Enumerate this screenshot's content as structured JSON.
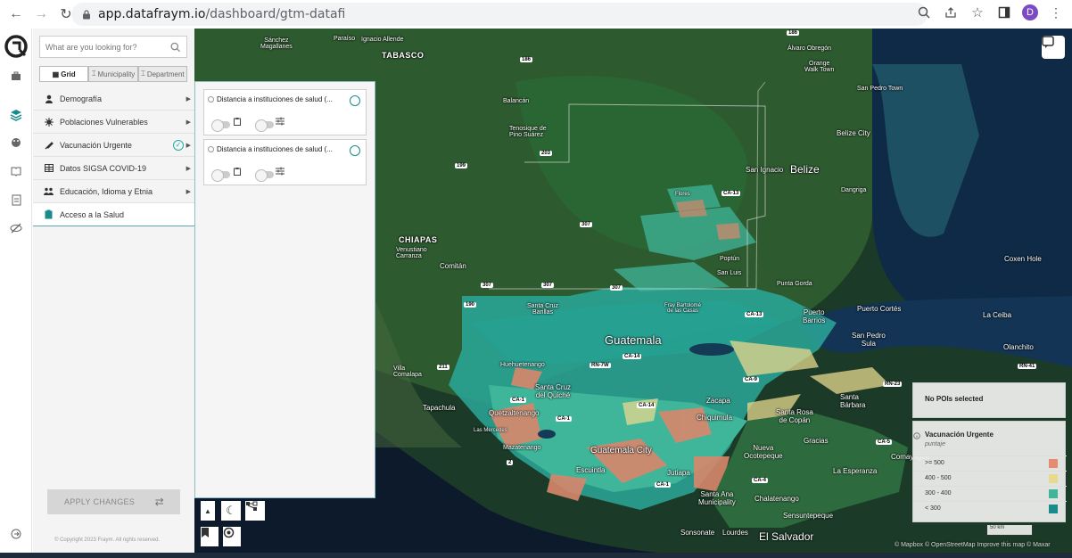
{
  "browser": {
    "url_host": "app.datafraym.io",
    "url_path": "/dashboard/gtm-datafi",
    "profile_initial": "D"
  },
  "search": {
    "placeholder": "What are you looking for?"
  },
  "tabs": [
    {
      "label": "Grid"
    },
    {
      "label": "Municipality"
    },
    {
      "label": "Department"
    }
  ],
  "menu": [
    {
      "label": "Demografía",
      "icon": "person-icon"
    },
    {
      "label": "Poblaciones Vulnerables",
      "icon": "virus-icon"
    },
    {
      "label": "Vacunación Urgente",
      "icon": "syringe-icon"
    },
    {
      "label": "Datos SIGSA COVID-19",
      "icon": "table-icon"
    },
    {
      "label": "Educación, Idioma y Etnia",
      "icon": "people-icon"
    },
    {
      "label": "Acceso a la Salud",
      "icon": "clipboard-icon"
    }
  ],
  "apply_label": "APPLY CHANGES",
  "copyright": "© Copyright 2023 Fraym. All rights reserved.",
  "layers": [
    {
      "title": "Distancia a instituciones de salud (..."
    },
    {
      "title": "Distancia a instituciones de salud (..."
    }
  ],
  "map_labels": {
    "sanchez": "Sánchez\nMagallanes",
    "paraiso": "Paraíso",
    "ignacio": "Ignacio Allende",
    "tabasco": "TABASCO",
    "balancan": "Balancán",
    "tenosique": "Tenosique de\nPino Suárez",
    "chiapas": "CHIAPAS",
    "venustiano": "Venustiano\nCarranza",
    "comitan": "Comitán",
    "villa": "Villa\nComalapa",
    "tapachula": "Tapachula",
    "huehuetenango": "Huehuetenango",
    "santacruz_b": "Santa Cruz\nBarillas",
    "santacruz_q": "Santa Cruz\ndel Quiché",
    "quetzal": "Quetzaltenango",
    "mazate": "Mazatenango",
    "escuintla": "Escuintla",
    "guatemala": "Guatemala",
    "guatecity": "Guatemala City",
    "jutiapa": "Jutiapa",
    "santaana": "Santa Ana\nMunicipality",
    "chalatenango": "Chalatenango",
    "sensuntepeque": "Sensuntepeque",
    "sonsonate": "Sonsonate",
    "lourdes": "Lourdes",
    "elsalvador": "El Salvador",
    "zacapa": "Zacapa",
    "chiquimula": "Chiquimula",
    "nueva": "Nueva\nOcotepeque",
    "gracias": "Gracias",
    "santarosa": "Santa Rosa\nde Copán",
    "santabarbara": "Santa\nBárbara",
    "fray": "Fray Bartolomé\nde las Casas",
    "poptun": "Poptún",
    "sanluis": "San Luis",
    "flores": "Flores",
    "belize": "Belize",
    "belizecity": "Belize City",
    "sanignacio": "San Ignacio",
    "dangriga": "Dangriga",
    "puntagorda": "Punta Gorda",
    "puertobarrios": "Puerto\nBarrios",
    "puertocortes": "Puerto Cortés",
    "sanpedrosula": "San Pedro\nSula",
    "laceiba": "La Ceiba",
    "olanchito": "Olanchito",
    "coxenhole": "Coxen Hole",
    "orange": "Orange\nWalk Town",
    "alvaro": "Álvaro Obregón",
    "sanpedrotown": "San Pedro Town",
    "laesperanza": "La Esperanza",
    "comayagua": "Comayagua",
    "sanmarcos": "Las Mercedes"
  },
  "poi_label": "No POIs selected",
  "legend": {
    "title": "Vacunación Urgente",
    "subtitle": "puntaje",
    "items": [
      {
        "label": ">= 500",
        "color": "#e58b70"
      },
      {
        "label": "400 - 500",
        "color": "#e8d98e"
      },
      {
        "label": "300 - 400",
        "color": "#3fb59a"
      },
      {
        "label": "< 300",
        "color": "#1a8a8c"
      }
    ]
  },
  "scale": "50 km",
  "attribution": "© Mapbox © OpenStreetMap Improve this map © Maxar"
}
